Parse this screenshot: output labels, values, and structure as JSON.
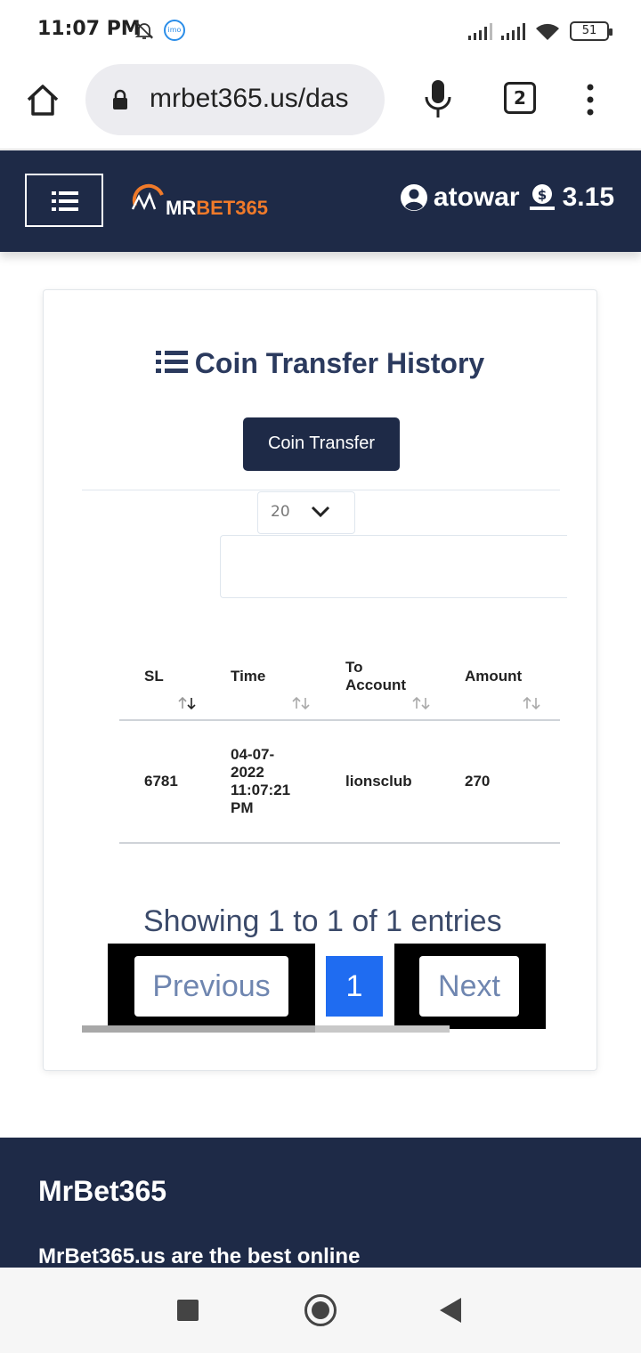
{
  "status_bar": {
    "time": "11:07 PM",
    "imo_label": "imo",
    "battery": "51",
    "icons": [
      "bell-off-icon",
      "imo-icon",
      "signal-icon",
      "signal-icon",
      "wifi-icon",
      "battery-icon"
    ]
  },
  "browser": {
    "url": "mrbet365.us/das",
    "tab_count": "2",
    "icons": [
      "home-icon",
      "lock-icon",
      "mic-icon",
      "tabs-icon",
      "more-vert-icon"
    ]
  },
  "header": {
    "logo_mr": "MR",
    "logo_bet": "BET365",
    "username": "atowar",
    "balance": "3.15",
    "colors": {
      "navy": "#1e2a47",
      "orange": "#f07a2a"
    }
  },
  "card": {
    "title": "Coin Transfer History",
    "button_label": "Coin Transfer",
    "page_length": "20",
    "search_value": "",
    "columns": [
      "SL",
      "Time",
      "To Account",
      "Amount"
    ],
    "column_to_line1": "To",
    "column_to_line2": "Account",
    "rows": [
      {
        "sl": "6781",
        "time_line1": "04-07-",
        "time_line2": "2022",
        "time_line3": "11:07:21",
        "time_line4": "PM",
        "to_account": "lionsclub",
        "amount": "270"
      }
    ],
    "info": "Showing 1 to 1 of 1 entries",
    "pagination": {
      "previous": "Previous",
      "current": "1",
      "next": "Next"
    },
    "accent": "#1f6cf1"
  },
  "footer": {
    "title": "MrBet365",
    "text": "MrBet365.us are the best online"
  }
}
